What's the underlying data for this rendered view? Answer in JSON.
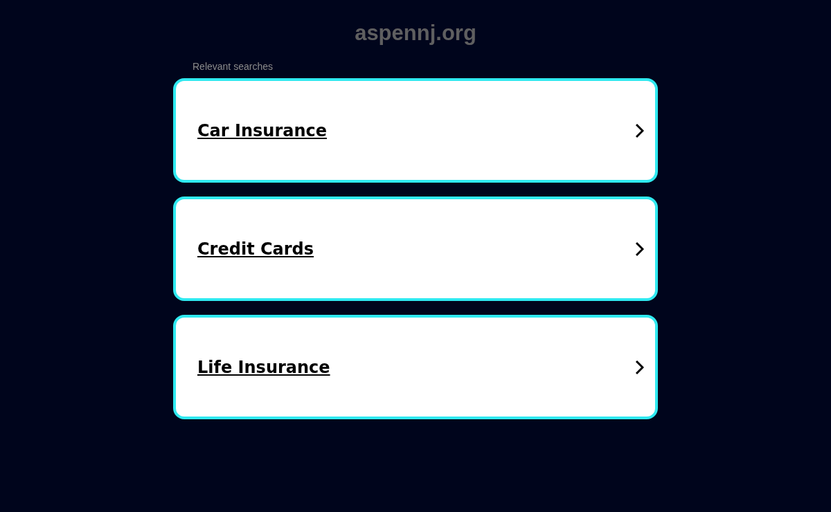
{
  "site_title": "aspennj.org",
  "section_label": "Relevant searches",
  "links": [
    {
      "label": "Car Insurance"
    },
    {
      "label": "Credit Cards"
    },
    {
      "label": "Life Insurance"
    }
  ]
}
